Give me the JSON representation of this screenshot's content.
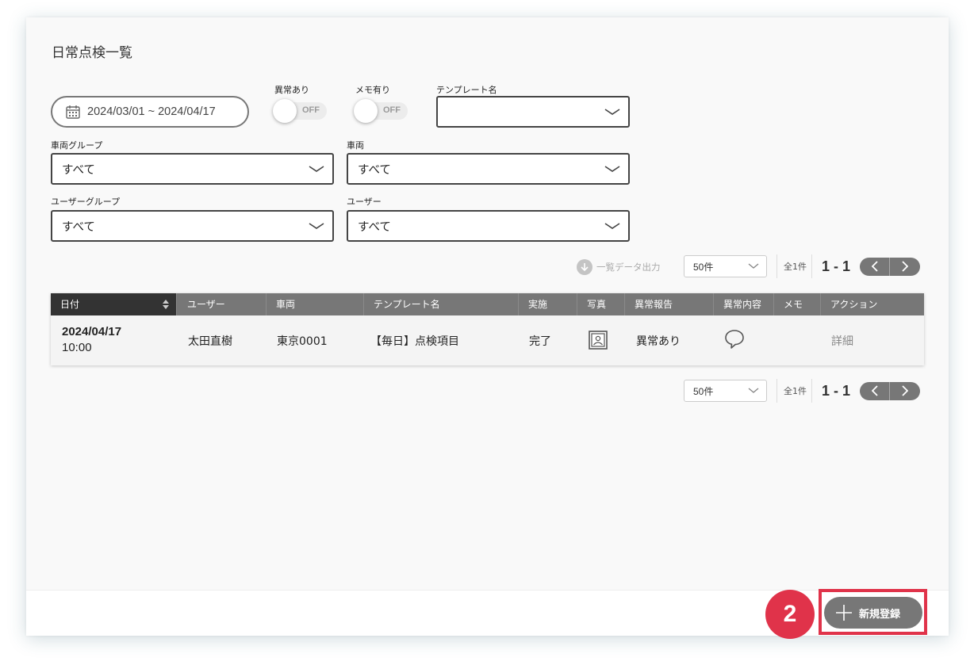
{
  "page": {
    "title": "日常点検一覧"
  },
  "filters": {
    "date_range": "2024/03/01 ~ 2024/04/17",
    "anomaly": {
      "label": "異常あり",
      "state": "OFF"
    },
    "memo": {
      "label": "メモ有り",
      "state": "OFF"
    },
    "template": {
      "label": "テンプレート名",
      "value": ""
    },
    "vehicle_group": {
      "label": "車両グループ",
      "value": "すべて"
    },
    "vehicle": {
      "label": "車両",
      "value": "すべて"
    },
    "user_group": {
      "label": "ユーザーグループ",
      "value": "すべて"
    },
    "user": {
      "label": "ユーザー",
      "value": "すべて"
    }
  },
  "export": {
    "label": "一覧データ出力"
  },
  "pagination": {
    "per_page": "50件",
    "total": "全1件",
    "range": "1 - 1"
  },
  "table": {
    "headers": [
      "日付",
      "ユーザー",
      "車両",
      "テンプレート名",
      "実施",
      "写真",
      "異常報告",
      "異常内容",
      "メモ",
      "アクション"
    ],
    "rows": [
      {
        "date": "2024/04/17",
        "time": "10:00",
        "user": "太田直樹",
        "vehicle": "東京0001",
        "template": "【毎日】点検項目",
        "status": "完了",
        "photo_icon": "photo-icon",
        "anomaly_report": "異常あり",
        "anomaly_detail_icon": "speech-bubble-icon",
        "memo": "",
        "action": "詳細"
      }
    ]
  },
  "footer": {
    "step_number": "2",
    "new_button": "新規登録"
  },
  "colors": {
    "accent_red": "#e0334a",
    "header_gray": "#777777",
    "sorted_header": "#333333"
  }
}
